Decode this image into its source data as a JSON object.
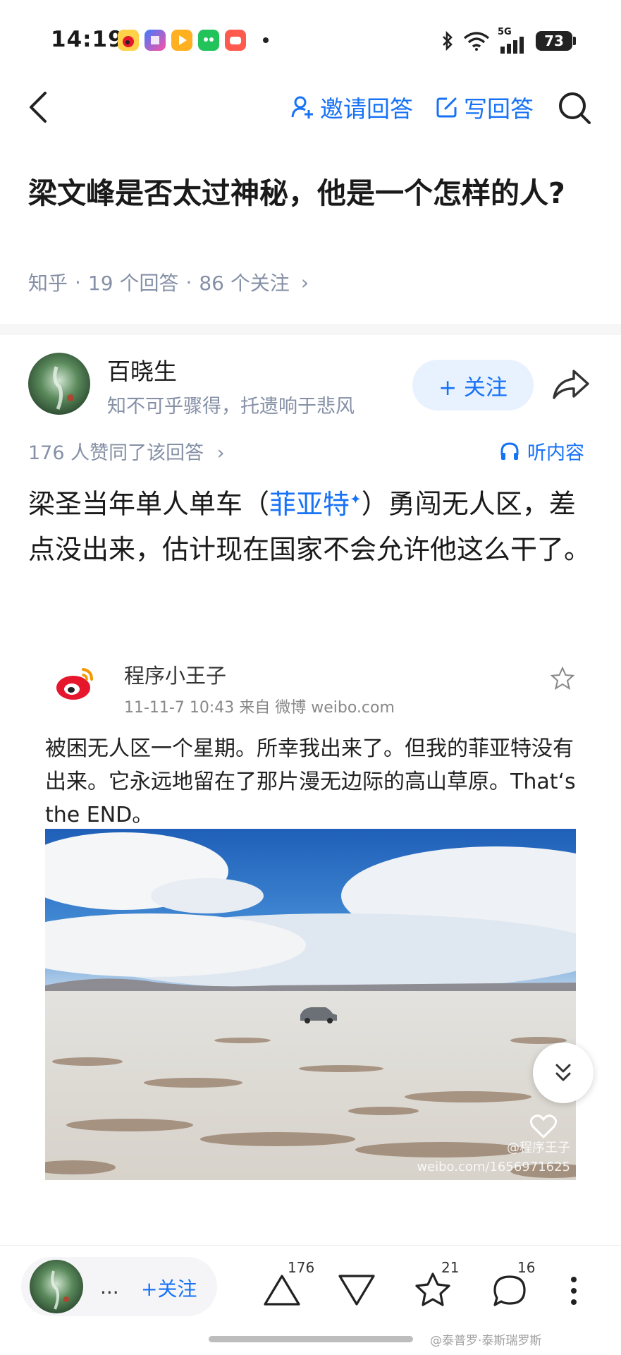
{
  "status_bar": {
    "time": "14:19",
    "network": "5G",
    "battery": "73"
  },
  "nav": {
    "invite_label": "邀请回答",
    "write_label": "写回答"
  },
  "question": {
    "title": "梁文峰是否太过神秘，他是一个怎样的人?",
    "source": "知乎",
    "answers": "19 个回答",
    "followers": "86 个关注",
    "sep": "·",
    "chevron": "›"
  },
  "author": {
    "name": "百晓生",
    "signature": "知不可乎骤得，托遗响于悲风",
    "follow_label": "+ 关注"
  },
  "answer": {
    "votes_text": "176 人赞同了该回答",
    "listen_label": "听内容",
    "text_before": "梁圣当年单人单车（",
    "link_text": "菲亚特",
    "link_mark": "✦",
    "text_after": "）勇闯无人区，差点没出来，估计现在国家不会允许他这么干了。"
  },
  "weibo": {
    "name": "程序小王子",
    "meta": "11-11-7 10:43  来自 微博 weibo.com",
    "text": "被困无人区一个星期。所幸我出来了。但我的菲亚特没有出来。它永远地留在了那片漫无边际的高山草原。That‘s the END。",
    "photo_watermark_1": "@程序王子",
    "photo_watermark_2": "weibo.com/1656971625"
  },
  "bottom_bar": {
    "dots": "...",
    "follow_label": "+关注",
    "upvotes": "176",
    "favorites": "21",
    "comments": "16"
  },
  "watermark": "@泰普罗·泰斯瑞罗斯",
  "colors": {
    "accent": "#1772f6",
    "meta": "#8590a6"
  }
}
